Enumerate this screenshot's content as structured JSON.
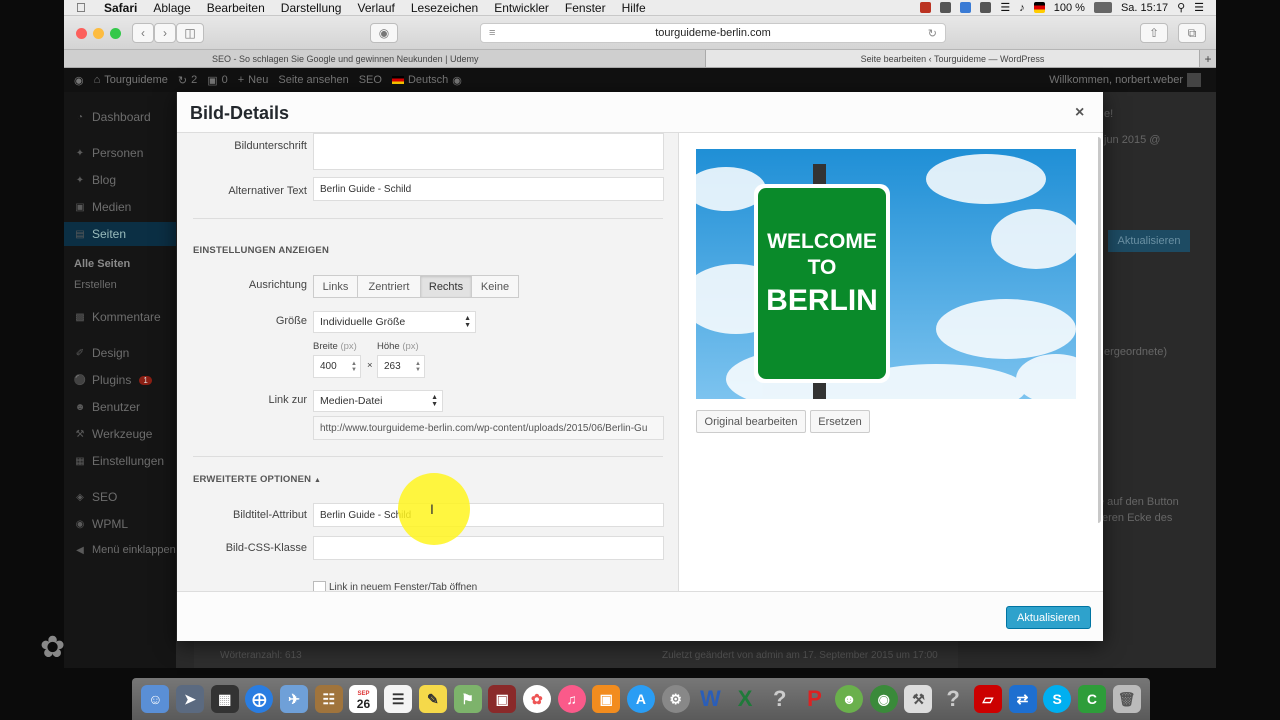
{
  "menubar": {
    "apple": "",
    "app": "Safari",
    "items": [
      "Ablage",
      "Bearbeiten",
      "Darstellung",
      "Verlauf",
      "Lesezeichen",
      "Entwickler",
      "Fenster",
      "Hilfe"
    ],
    "battery": "100 %",
    "clock": "Sa. 15:17"
  },
  "browser": {
    "url": "tourguideme-berlin.com",
    "tabs": [
      "SEO - So schlagen Sie Google und gewinnen Neukunden | Udemy",
      "Seite bearbeiten ‹ Tourguideme — WordPress"
    ],
    "new_tab": "+"
  },
  "adminbar": {
    "site": "Tourguideme",
    "updates": "2",
    "comments": "0",
    "new": "Neu",
    "view": "Seite ansehen",
    "seo": "SEO",
    "lang": "Deutsch",
    "welcome": "Willkommen, norbert.weber"
  },
  "sidebar": {
    "items": [
      "Dashboard",
      "Personen",
      "Blog",
      "Medien",
      "Seiten",
      "Kommentare",
      "Design",
      "Plugins",
      "Benutzer",
      "Werkzeuge",
      "Einstellungen",
      "SEO",
      "WPML",
      "Menü einklappen"
    ],
    "sub": [
      "Alle Seiten",
      "Erstellen"
    ],
    "plugins_badge": "1"
  },
  "background": {
    "snippet1": "e!",
    "snippet2": "jun 2015 @",
    "button": "Aktualisieren",
    "dropdown": "ergeordnete)",
    "text1": "e auf den Button",
    "text2": "eren Ecke des",
    "words": "Wörteranzahl: 613",
    "last_edit": "Zuletzt geändert von admin am 17. September 2015 um 17:00"
  },
  "modal": {
    "title": "Bild-Details",
    "close": "×",
    "caption_label": "Bildunterschrift",
    "caption_value": "",
    "alt_label": "Alternativer Text",
    "alt_value": "Berlin Guide - Schild",
    "display_section": "EINSTELLUNGEN ANZEIGEN",
    "align_label": "Ausrichtung",
    "align_options": [
      "Links",
      "Zentriert",
      "Rechts",
      "Keine"
    ],
    "align_selected": "Rechts",
    "size_label": "Größe",
    "size_value": "Individuelle Größe",
    "width_label": "Breite",
    "height_label": "Höhe",
    "px_unit": "(px)",
    "width_value": "400",
    "height_value": "263",
    "times": "×",
    "link_label": "Link zur",
    "link_value": "Medien-Datei",
    "link_url": "http://www.tourguideme-berlin.com/wp-content/uploads/2015/06/Berlin-Gu",
    "advanced_section": "ERWEITERTE OPTIONEN",
    "advanced_arrow": "▲",
    "title_attr_label": "Bildtitel-Attribut",
    "title_attr_value": "Berlin Guide - Schild",
    "css_label": "Bild-CSS-Klasse",
    "css_value": "",
    "new_window_label": "Link in neuem Fenster/Tab öffnen",
    "sign_line1": "WELCOME",
    "sign_line2": "TO",
    "sign_line3": "BERLIN",
    "edit_original": "Original bearbeiten",
    "replace": "Ersetzen",
    "update": "Aktualisieren"
  },
  "dock": {
    "calendar_month": "SEP",
    "calendar_day": "26",
    "word": "W",
    "excel": "X",
    "help": "?",
    "skype": "S"
  }
}
